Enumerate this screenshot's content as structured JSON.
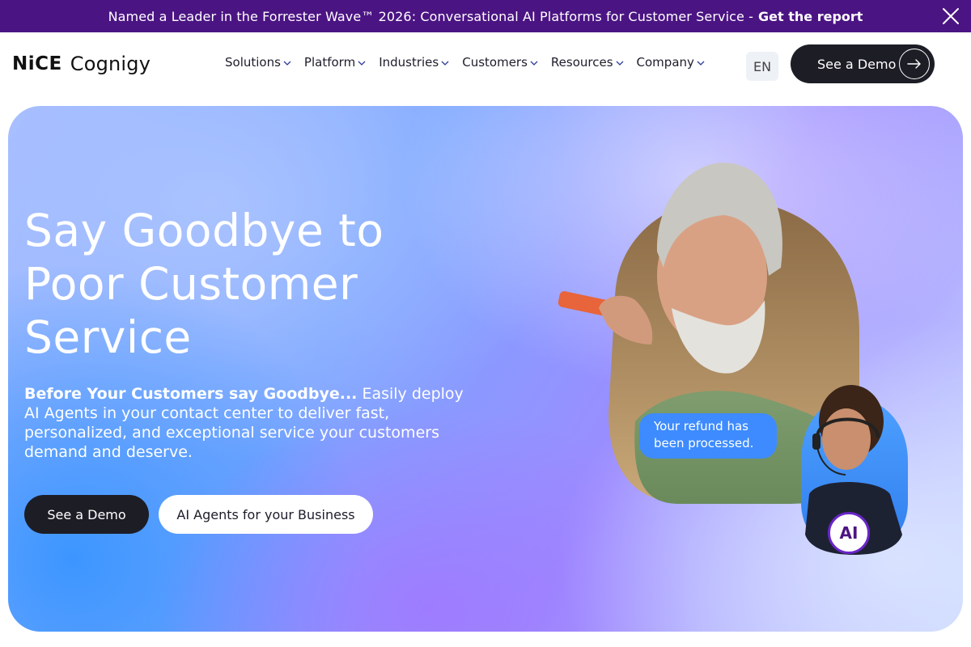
{
  "announcement": {
    "message": "Named a Leader in the Forrester Wave™ 2026: Conversational AI Platforms for Customer Service -",
    "link_label": "Get the report"
  },
  "brand": {
    "name_part1": "NiCE",
    "name_part2": "Cognigy"
  },
  "nav": {
    "items": [
      {
        "label": "Solutions"
      },
      {
        "label": "Platform"
      },
      {
        "label": "Industries"
      },
      {
        "label": "Customers"
      },
      {
        "label": "Resources"
      },
      {
        "label": "Company"
      }
    ],
    "language": "EN",
    "demo_label": "See a Demo"
  },
  "hero": {
    "headline": "Say Goodbye to Poor Customer Service",
    "sub_strong": "Before Your Customers say Goodbye...",
    "sub_text": " Easily deploy AI Agents in your contact center to deliver fast, personalized, and exceptional service your customers demand and deserve.",
    "cta_primary": "See a Demo",
    "cta_secondary": "AI Agents for your Business",
    "chat_bubble": "Your refund has been processed.",
    "ai_badge": "AI"
  },
  "colors": {
    "announcement_bg": "#4b1483",
    "button_dark": "#1d1d26",
    "bubble_blue": "#3d8bff",
    "ai_ring": "#6a26c9"
  }
}
